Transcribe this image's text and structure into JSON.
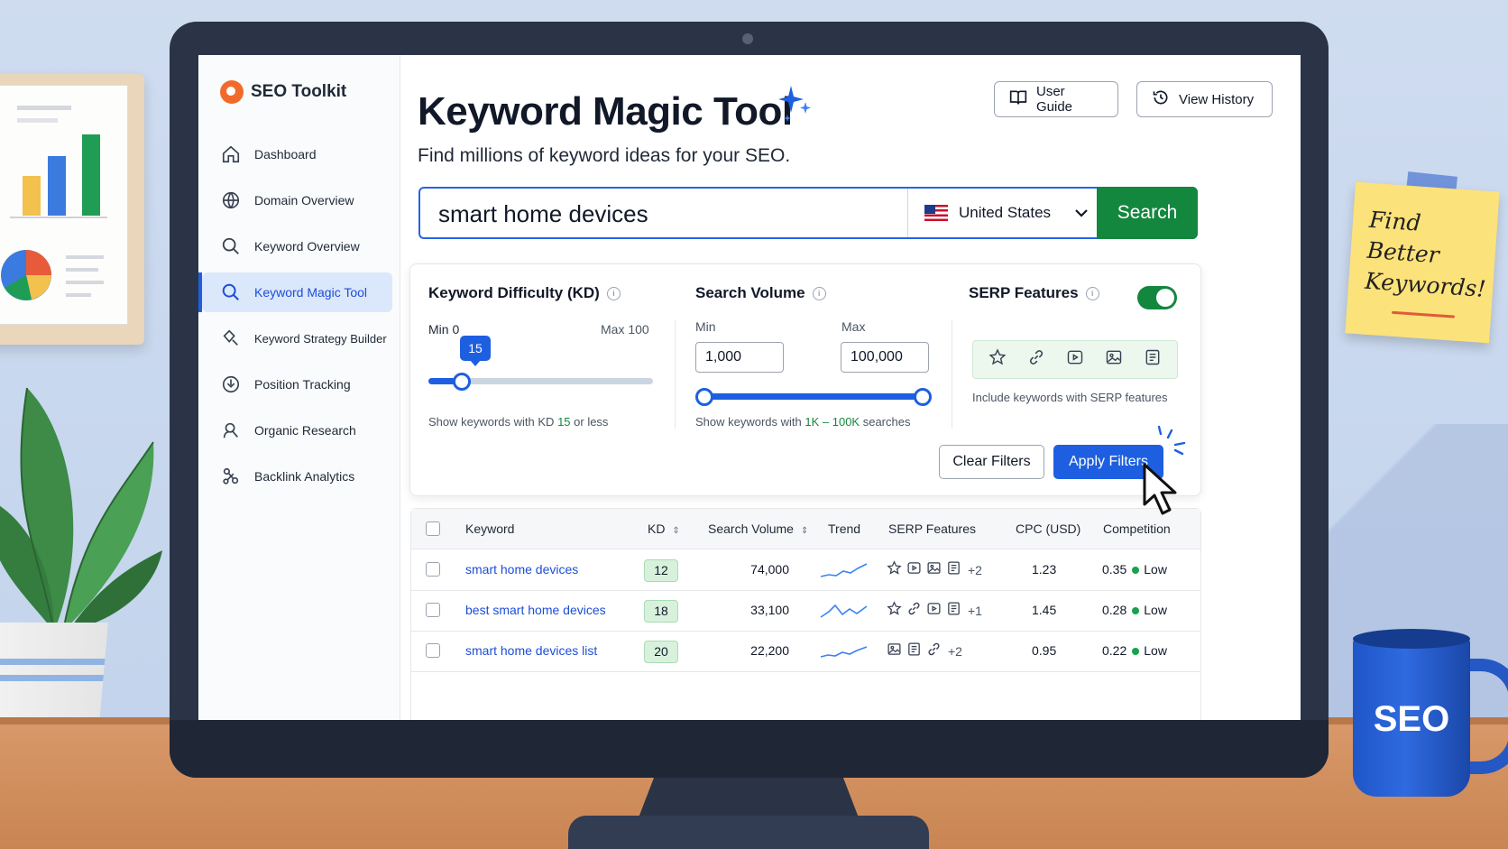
{
  "brand": {
    "name": "SEO Toolkit"
  },
  "sidebar": {
    "items": [
      {
        "label": "Dashboard",
        "icon": "home-icon"
      },
      {
        "label": "Domain Overview",
        "icon": "globe-icon"
      },
      {
        "label": "Keyword Overview",
        "icon": "search-icon"
      },
      {
        "label": "Keyword Magic Tool",
        "icon": "search-icon",
        "active": true
      },
      {
        "label": "Keyword Strategy Builder",
        "icon": "strategy-search-icon"
      },
      {
        "label": "Position Tracking",
        "icon": "position-tracking-icon"
      },
      {
        "label": "Organic Research",
        "icon": "organic-research-icon"
      },
      {
        "label": "Backlink Analytics",
        "icon": "link-nodes-icon"
      }
    ]
  },
  "header": {
    "title": "Keyword Magic Tool",
    "subtitle": "Find millions of keyword ideas for your SEO.",
    "user_guide_label": "User Guide",
    "view_history_label": "View History"
  },
  "search": {
    "query": "smart home devices",
    "country": "United States",
    "button_label": "Search"
  },
  "filters": {
    "kd": {
      "heading": "Keyword Difficulty (KD)",
      "min_label": "Min 0",
      "max_label": "Max 100",
      "value": "15",
      "value_fraction": 0.15,
      "note_prefix": "Show keywords with KD ",
      "note_value": "15",
      "note_suffix": " or less"
    },
    "volume": {
      "heading": "Search Volume",
      "min_label": "Min",
      "max_label": "Max",
      "min_value": "1,000",
      "max_value": "100,000",
      "note_prefix": "Show keywords with ",
      "note_value": "1K – 100K",
      "note_suffix": " searches"
    },
    "serp": {
      "heading": "SERP Features",
      "enabled": true,
      "icons": [
        "star-icon",
        "link-icon",
        "video-icon",
        "image-icon",
        "document-icon"
      ],
      "note": "Include keywords with SERP features"
    },
    "clear_label": "Clear Filters",
    "apply_label": "Apply Filters"
  },
  "table": {
    "headers": {
      "keyword": "Keyword",
      "kd": "KD",
      "volume": "Search Volume",
      "trend": "Trend",
      "serp": "SERP Features",
      "cpc": "CPC (USD)",
      "competition": "Competition"
    },
    "rows": [
      {
        "keyword": "smart home devices",
        "kd": "12",
        "volume": "74,000",
        "serp_icons": [
          "star-icon",
          "video-icon",
          "image-icon",
          "document-icon"
        ],
        "serp_more": "+2",
        "cpc": "1.23",
        "competition_value": "0.35",
        "competition_level": "Low"
      },
      {
        "keyword": "best smart home devices",
        "kd": "18",
        "volume": "33,100",
        "serp_icons": [
          "star-icon",
          "link-icon",
          "video-icon",
          "document-icon"
        ],
        "serp_more": "+1",
        "cpc": "1.45",
        "competition_value": "0.28",
        "competition_level": "Low"
      },
      {
        "keyword": "smart home devices list",
        "kd": "20",
        "volume": "22,200",
        "serp_icons": [
          "image-icon",
          "document-icon",
          "link-icon"
        ],
        "serp_more": "+2",
        "cpc": "0.95",
        "competition_value": "0.22",
        "competition_level": "Low"
      }
    ]
  },
  "scene": {
    "sticky_note": "Find Better Keywords!",
    "mug_text": "SEO"
  },
  "colors": {
    "accent": "#1d5fe0",
    "search_green": "#14873f",
    "brand_orange": "#f26a2b"
  }
}
